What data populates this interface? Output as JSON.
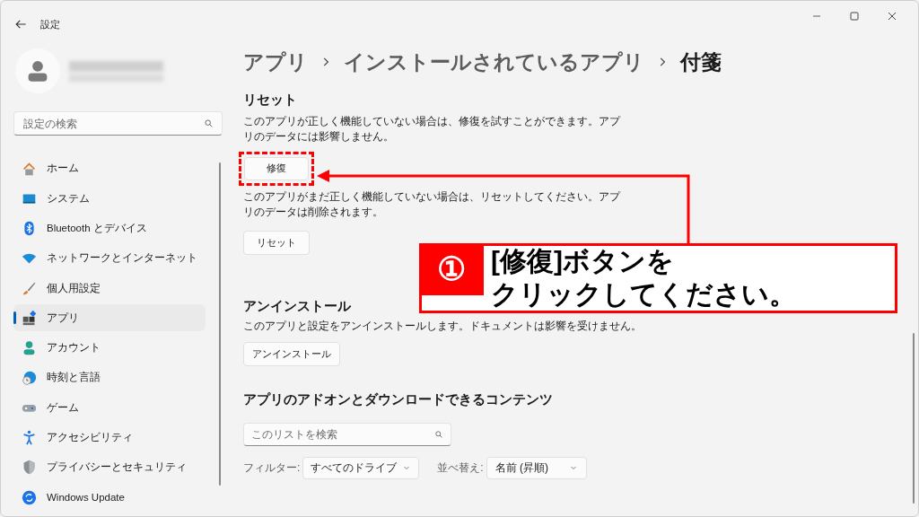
{
  "window": {
    "title": "設定"
  },
  "search": {
    "placeholder": "設定の検索"
  },
  "nav": [
    {
      "label": "ホーム",
      "selected": false
    },
    {
      "label": "システム",
      "selected": false
    },
    {
      "label": "Bluetooth とデバイス",
      "selected": false
    },
    {
      "label": "ネットワークとインターネット",
      "selected": false
    },
    {
      "label": "個人用設定",
      "selected": false
    },
    {
      "label": "アプリ",
      "selected": true
    },
    {
      "label": "アカウント",
      "selected": false
    },
    {
      "label": "時刻と言語",
      "selected": false
    },
    {
      "label": "ゲーム",
      "selected": false
    },
    {
      "label": "アクセシビリティ",
      "selected": false
    },
    {
      "label": "プライバシーとセキュリティ",
      "selected": false
    },
    {
      "label": "Windows Update",
      "selected": false
    }
  ],
  "breadcrumb": [
    "アプリ",
    "インストールされているアプリ",
    "付箋"
  ],
  "reset_section": {
    "title": "リセット",
    "repair_text": "このアプリが正しく機能していない場合は、修復を試すことができます。アプリのデータには影響しません。",
    "repair_button": "修復",
    "reset_text": "このアプリがまだ正しく機能していない場合は、リセットしてください。アプリのデータは削除されます。",
    "reset_button": "リセット"
  },
  "uninstall_section": {
    "title": "アンインストール",
    "text": "このアプリと設定をアンインストールします。ドキュメントは影響を受けません。",
    "button": "アンインストール"
  },
  "addons_section": {
    "title": "アプリのアドオンとダウンロードできるコンテンツ",
    "search_placeholder": "このリストを検索",
    "filter_label": "フィルター:",
    "filter_value": "すべてのドライブ",
    "sort_label": "並べ替え:",
    "sort_value": "名前 (昇順)"
  },
  "callout": {
    "number": "①",
    "lines": [
      "[修復]ボタンを",
      "クリックしてください。"
    ]
  }
}
